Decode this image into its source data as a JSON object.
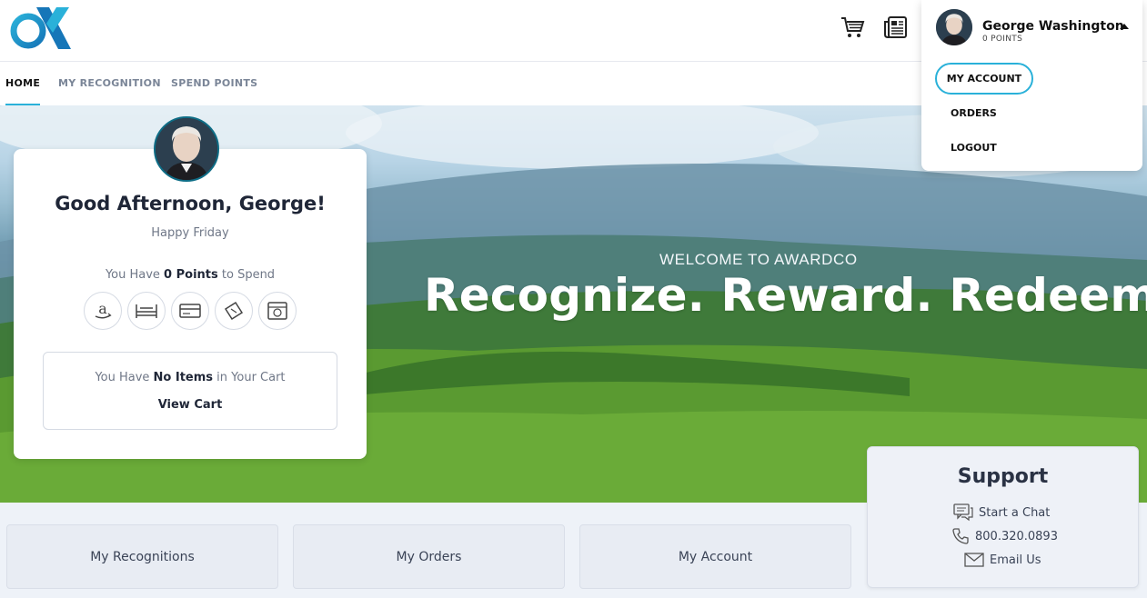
{
  "header": {
    "logo_icon": "awardco-logo",
    "cart_icon": "cart-icon",
    "news_icon": "newspaper-icon"
  },
  "nav": {
    "tabs": [
      {
        "label": "HOME",
        "active": true
      },
      {
        "label": "MY RECOGNITION",
        "active": false
      },
      {
        "label": "SPEND POINTS",
        "active": false
      }
    ]
  },
  "user_menu": {
    "name": "George Washington",
    "points": "0 POINTS",
    "items": [
      "MY ACCOUNT",
      "ORDERS",
      "LOGOUT"
    ]
  },
  "hero": {
    "subtitle": "WELCOME TO AWARDCO",
    "title": "Recognize. Reward. Redeem."
  },
  "greeting": {
    "title": "Good Afternoon, George!",
    "subtitle": "Happy Friday",
    "points_prefix": "You Have ",
    "points_value": "0 Points",
    "points_suffix": " to Spend",
    "categories": [
      "amazon-icon",
      "bed-icon",
      "card-icon",
      "ticket-icon",
      "gift-card-icon"
    ],
    "cart_prefix": "You Have ",
    "cart_value": "No Items",
    "cart_suffix": " in Your Cart",
    "view_cart": "View Cart"
  },
  "tiles": [
    "My Recognitions",
    "My Orders",
    "My Account"
  ],
  "support": {
    "title": "Support",
    "chat": "Start a Chat",
    "phone": "800.320.0893",
    "email": "Email Us"
  },
  "colors": {
    "accent": "#2ab1d9",
    "text_dark": "#1f2637",
    "text_muted": "#6f7787"
  }
}
